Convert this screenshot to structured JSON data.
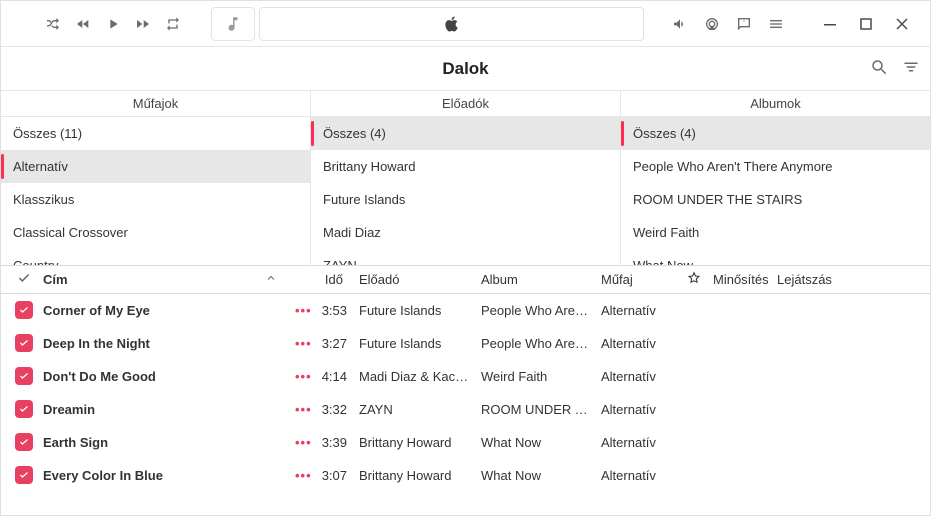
{
  "header": {
    "view_title": "Dalok"
  },
  "browser": {
    "cols": [
      {
        "title": "Műfajok",
        "items": [
          {
            "label": "Összes (11)",
            "selected": false
          },
          {
            "label": "Alternatív",
            "selected": true
          },
          {
            "label": "Klasszikus",
            "selected": false
          },
          {
            "label": "Classical Crossover",
            "selected": false
          },
          {
            "label": "Country",
            "selected": false
          }
        ]
      },
      {
        "title": "Előadók",
        "items": [
          {
            "label": "Összes (4)",
            "selected": true
          },
          {
            "label": "Brittany Howard",
            "selected": false
          },
          {
            "label": "Future Islands",
            "selected": false
          },
          {
            "label": "Madi Diaz",
            "selected": false
          },
          {
            "label": "ZAYN",
            "selected": false
          }
        ]
      },
      {
        "title": "Albumok",
        "items": [
          {
            "label": "Összes (4)",
            "selected": true
          },
          {
            "label": "People Who Aren't There Anymore",
            "selected": false
          },
          {
            "label": "ROOM UNDER THE STAIRS",
            "selected": false
          },
          {
            "label": "Weird Faith",
            "selected": false
          },
          {
            "label": "What Now",
            "selected": false
          }
        ]
      }
    ]
  },
  "table": {
    "headers": {
      "title": "Cím",
      "time": "Idő",
      "artist": "Előadó",
      "album": "Album",
      "genre": "Műfaj",
      "rating": "Minősítés",
      "plays": "Lejátszás"
    },
    "rows": [
      {
        "checked": true,
        "title": "Corner of My Eye",
        "time": "3:53",
        "artist": "Future Islands",
        "album": "People Who Aren't T…",
        "genre": "Alternatív"
      },
      {
        "checked": true,
        "title": "Deep In the Night",
        "time": "3:27",
        "artist": "Future Islands",
        "album": "People Who Aren't T…",
        "genre": "Alternatív"
      },
      {
        "checked": true,
        "title": "Don't Do Me Good",
        "time": "4:14",
        "artist": "Madi Diaz & Kacey…",
        "album": "Weird Faith",
        "genre": "Alternatív"
      },
      {
        "checked": true,
        "title": "Dreamin",
        "time": "3:32",
        "artist": "ZAYN",
        "album": "ROOM UNDER THE…",
        "genre": "Alternatív"
      },
      {
        "checked": true,
        "title": "Earth Sign",
        "time": "3:39",
        "artist": "Brittany Howard",
        "album": "What Now",
        "genre": "Alternatív"
      },
      {
        "checked": true,
        "title": "Every Color In Blue",
        "time": "3:07",
        "artist": "Brittany Howard",
        "album": "What Now",
        "genre": "Alternatív"
      }
    ]
  }
}
